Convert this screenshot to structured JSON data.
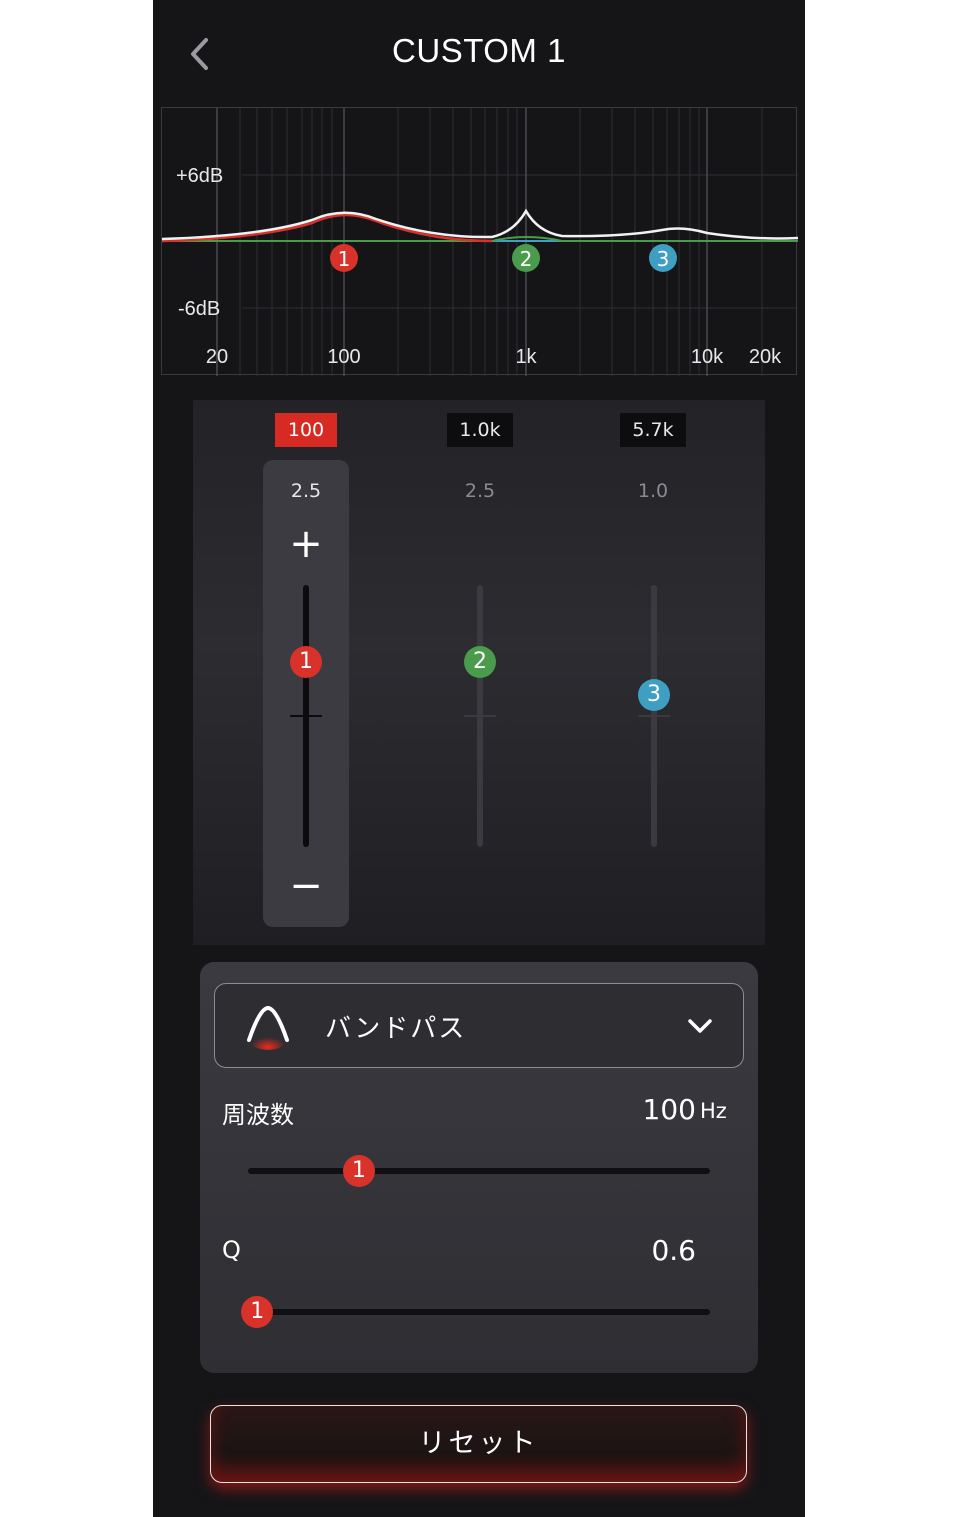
{
  "header": {
    "title": "CUSTOM 1",
    "back_icon": "chevron-left-icon"
  },
  "graph": {
    "y_labels": {
      "top": "+6dB",
      "bottom": "-6dB"
    },
    "x_labels": [
      "20",
      "100",
      "1k",
      "10k",
      "20k"
    ],
    "band_markers": [
      "1",
      "2",
      "3"
    ]
  },
  "bands": [
    {
      "number": "1",
      "freq": "100",
      "q": "2.5",
      "color": "#d8322b",
      "selected": true,
      "gain_db": 2.5
    },
    {
      "number": "2",
      "freq": "1.0k",
      "q": "2.5",
      "color": "#4a9b4c",
      "selected": false,
      "gain_db": 2.5
    },
    {
      "number": "3",
      "freq": "5.7k",
      "q": "1.0",
      "color": "#3e9fc2",
      "selected": false,
      "gain_db": 1.0
    }
  ],
  "gain_controls": {
    "plus": "+",
    "minus": "−"
  },
  "filter": {
    "type_label": "バンドパス",
    "type_icon": "bandpass-icon",
    "dropdown_icon": "chevron-down-icon",
    "frequency_label": "周波数",
    "frequency_value": "100",
    "frequency_unit": "Hz",
    "frequency_marker": "1",
    "frequency_position": 0.24,
    "q_label": "Q",
    "q_value": "0.6",
    "q_marker": "1",
    "q_position": 0.02
  },
  "reset_label": "リセット",
  "colors": {
    "accent": "#d62a22",
    "background": "#151518"
  }
}
